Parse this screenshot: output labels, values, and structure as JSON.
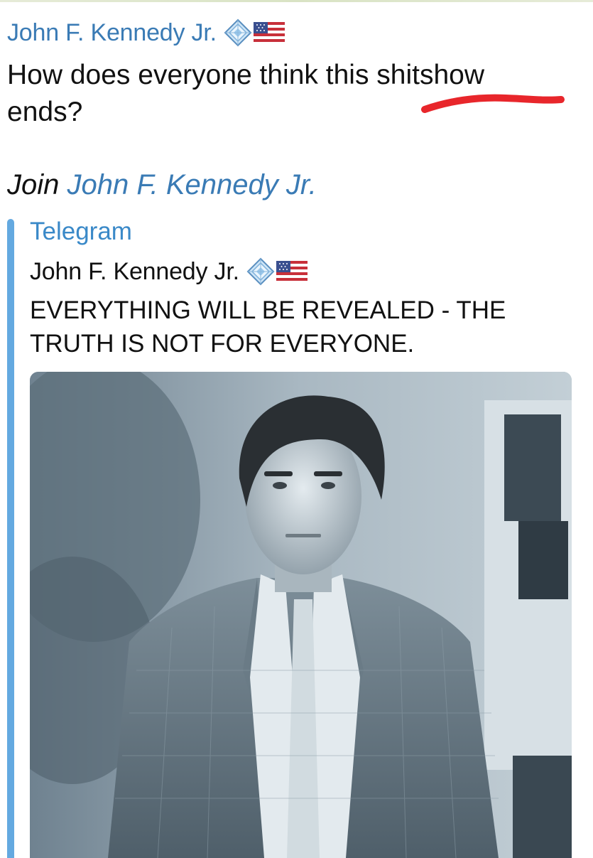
{
  "message": {
    "sender_name": "John F. Kennedy Jr.",
    "sender_badges": [
      "diamond-badge-icon",
      "us-flag-icon"
    ],
    "text_line1": "How does everyone think this shitshow",
    "text_line2": "ends?",
    "join_prefix": "Join",
    "join_link_text": "John F. Kennedy Jr."
  },
  "link_preview": {
    "site_name": "Telegram",
    "title": "John F. Kennedy Jr.",
    "title_badges": [
      "diamond-badge-icon",
      "us-flag-icon"
    ],
    "description_line1": "EVERYTHING WILL BE REVEALED - THE",
    "description_line2": "TRUTH IS NOT FOR EVERYONE.",
    "image": "black-and-white-portrait-photo"
  },
  "colors": {
    "link_blue": "#3a7bb5",
    "quote_bar": "#64a9e0",
    "annotation_red": "#e8262b",
    "text": "#111111"
  }
}
